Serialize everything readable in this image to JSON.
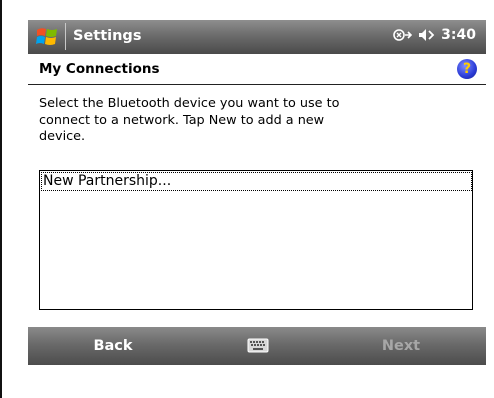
{
  "titlebar": {
    "app_title": "Settings",
    "time": "3:40",
    "icons": [
      "start-icon",
      "connectivity-icon",
      "volume-icon"
    ]
  },
  "header": {
    "page_title": "My Connections",
    "help_label": "?"
  },
  "instructions": "Select the Bluetooth device you want to use to connect to a network. Tap New to add a new device.",
  "device_list": {
    "items": [
      "New Partnership..."
    ]
  },
  "softbar": {
    "left_label": "Back",
    "right_label": "Next",
    "right_enabled": false,
    "center_icon": "keyboard-icon"
  },
  "colors": {
    "bar_top": "#8e8e8e",
    "bar_bottom": "#4a4a4a",
    "disabled_text": "#a7a7a7",
    "help_bg": "#2a3bd6",
    "help_fg": "#ffcc00"
  }
}
